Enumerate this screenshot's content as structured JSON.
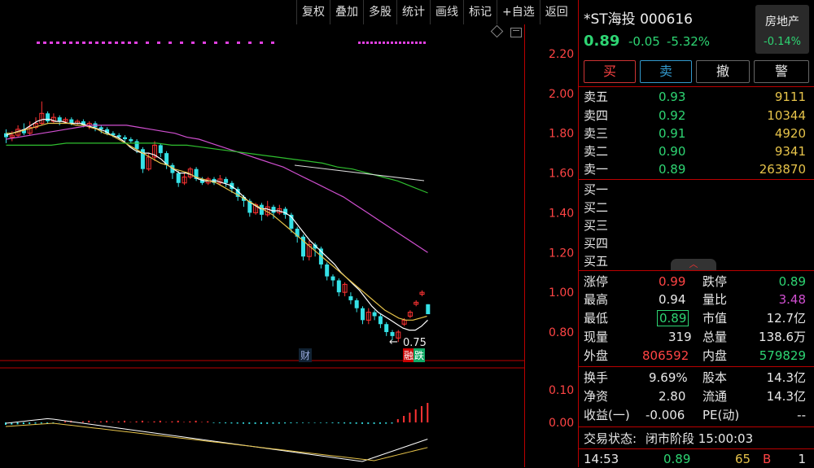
{
  "toolbar": [
    "复权",
    "叠加",
    "多股",
    "统计",
    "画线",
    "标记",
    "+自选",
    "返回"
  ],
  "axis": {
    "main_ticks": [
      "2.20",
      "2.00",
      "1.80",
      "1.60",
      "1.40",
      "1.20",
      "1.00",
      "0.80"
    ],
    "macd_ticks": [
      "0.10",
      "0.00"
    ]
  },
  "chart": {
    "low_label": "0.75",
    "marker_cai": "财",
    "marker_rong": "融",
    "marker_die": "跌",
    "colors": {
      "up": "#ff3333",
      "down": "#35e1e6",
      "ma5": "#ffffff",
      "ma10": "#e6c34a",
      "ma20": "#d04fd0",
      "ma60": "#2fbf2f",
      "magenta": "#e040e0"
    }
  },
  "chart_data": {
    "type": "candlestick",
    "ylim": [
      0.7,
      2.3
    ],
    "candles": [
      [
        1.8,
        1.78,
        1.82,
        1.75
      ],
      [
        1.78,
        1.79,
        1.81,
        1.76
      ],
      [
        1.79,
        1.82,
        1.84,
        1.78
      ],
      [
        1.82,
        1.8,
        1.85,
        1.79
      ],
      [
        1.8,
        1.83,
        1.86,
        1.79
      ],
      [
        1.83,
        1.85,
        1.88,
        1.82
      ],
      [
        1.85,
        1.9,
        1.96,
        1.84
      ],
      [
        1.9,
        1.86,
        1.91,
        1.85
      ],
      [
        1.86,
        1.88,
        1.9,
        1.85
      ],
      [
        1.88,
        1.86,
        1.89,
        1.84
      ],
      [
        1.86,
        1.87,
        1.88,
        1.85
      ],
      [
        1.87,
        1.85,
        1.88,
        1.84
      ],
      [
        1.85,
        1.86,
        1.87,
        1.84
      ],
      [
        1.86,
        1.84,
        1.87,
        1.83
      ],
      [
        1.84,
        1.85,
        1.86,
        1.82
      ],
      [
        1.85,
        1.83,
        1.86,
        1.81
      ],
      [
        1.83,
        1.82,
        1.84,
        1.8
      ],
      [
        1.82,
        1.8,
        1.83,
        1.79
      ],
      [
        1.8,
        1.79,
        1.81,
        1.78
      ],
      [
        1.79,
        1.78,
        1.8,
        1.77
      ],
      [
        1.78,
        1.77,
        1.79,
        1.76
      ],
      [
        1.77,
        1.76,
        1.78,
        1.75
      ],
      [
        1.76,
        1.72,
        1.77,
        1.7
      ],
      [
        1.72,
        1.62,
        1.73,
        1.6
      ],
      [
        1.62,
        1.68,
        1.7,
        1.61
      ],
      [
        1.68,
        1.74,
        1.76,
        1.66
      ],
      [
        1.74,
        1.7,
        1.75,
        1.68
      ],
      [
        1.7,
        1.64,
        1.71,
        1.62
      ],
      [
        1.64,
        1.6,
        1.65,
        1.57
      ],
      [
        1.6,
        1.55,
        1.61,
        1.53
      ],
      [
        1.55,
        1.58,
        1.6,
        1.54
      ],
      [
        1.58,
        1.62,
        1.63,
        1.57
      ],
      [
        1.62,
        1.57,
        1.63,
        1.56
      ],
      [
        1.57,
        1.55,
        1.58,
        1.54
      ],
      [
        1.55,
        1.57,
        1.58,
        1.54
      ],
      [
        1.57,
        1.55,
        1.58,
        1.54
      ],
      [
        1.55,
        1.57,
        1.59,
        1.54
      ],
      [
        1.57,
        1.55,
        1.58,
        1.53
      ],
      [
        1.55,
        1.52,
        1.56,
        1.5
      ],
      [
        1.52,
        1.48,
        1.53,
        1.46
      ],
      [
        1.48,
        1.46,
        1.49,
        1.43
      ],
      [
        1.46,
        1.4,
        1.47,
        1.38
      ],
      [
        1.4,
        1.44,
        1.45,
        1.39
      ],
      [
        1.44,
        1.39,
        1.45,
        1.36
      ],
      [
        1.39,
        1.43,
        1.46,
        1.38
      ],
      [
        1.43,
        1.4,
        1.44,
        1.37
      ],
      [
        1.4,
        1.42,
        1.44,
        1.39
      ],
      [
        1.42,
        1.39,
        1.43,
        1.37
      ],
      [
        1.39,
        1.32,
        1.4,
        1.3
      ],
      [
        1.32,
        1.28,
        1.33,
        1.25
      ],
      [
        1.28,
        1.18,
        1.29,
        1.16
      ],
      [
        1.18,
        1.24,
        1.26,
        1.16
      ],
      [
        1.24,
        1.22,
        1.25,
        1.18
      ],
      [
        1.22,
        1.14,
        1.23,
        1.12
      ],
      [
        1.14,
        1.08,
        1.15,
        1.06
      ],
      [
        1.08,
        1.06,
        1.09,
        1.03
      ],
      [
        1.06,
        1.0,
        1.07,
        0.98
      ],
      [
        1.0,
        1.04,
        1.05,
        0.98
      ],
      [
        0.98,
        0.96,
        1.0,
        0.94
      ],
      [
        0.96,
        0.92,
        0.97,
        0.9
      ],
      [
        0.92,
        0.86,
        0.93,
        0.84
      ],
      [
        0.86,
        0.9,
        0.92,
        0.84
      ],
      [
        0.9,
        0.88,
        0.91,
        0.86
      ],
      [
        0.88,
        0.84,
        0.89,
        0.82
      ],
      [
        0.84,
        0.8,
        0.85,
        0.78
      ],
      [
        0.8,
        0.78,
        0.81,
        0.76
      ],
      [
        0.77,
        0.8,
        0.81,
        0.75
      ],
      [
        0.84,
        0.86,
        0.87,
        0.83
      ],
      [
        0.88,
        0.9,
        0.91,
        0.87
      ],
      [
        0.94,
        0.95,
        0.96,
        0.93
      ],
      [
        0.99,
        1.0,
        1.01,
        0.98
      ],
      [
        0.94,
        0.89,
        0.94,
        0.89
      ]
    ],
    "ma5": [
      1.79,
      1.8,
      1.81,
      1.82,
      1.84,
      1.86,
      1.87,
      1.87,
      1.86,
      1.86,
      1.85,
      1.85,
      1.85,
      1.84,
      1.83,
      1.82,
      1.81,
      1.79,
      1.78,
      1.76,
      1.73,
      1.71,
      1.7,
      1.7,
      1.69,
      1.67,
      1.64,
      1.62,
      1.6,
      1.6,
      1.59,
      1.57,
      1.56,
      1.56,
      1.56,
      1.55,
      1.54,
      1.52,
      1.49,
      1.46,
      1.44,
      1.42,
      1.42,
      1.41,
      1.41,
      1.4,
      1.38,
      1.34,
      1.3,
      1.26,
      1.23,
      1.2,
      1.17,
      1.14,
      1.1,
      1.07,
      1.04,
      1.01,
      0.97,
      0.93,
      0.9,
      0.88,
      0.86,
      0.84,
      0.82,
      0.81,
      0.81,
      0.83,
      0.86
    ],
    "ma10": [
      1.8,
      1.8,
      1.81,
      1.82,
      1.83,
      1.84,
      1.85,
      1.85,
      1.85,
      1.85,
      1.84,
      1.84,
      1.83,
      1.82,
      1.8,
      1.79,
      1.77,
      1.75,
      1.73,
      1.71,
      1.69,
      1.67,
      1.65,
      1.64,
      1.62,
      1.61,
      1.6,
      1.58,
      1.57,
      1.56,
      1.55,
      1.53,
      1.51,
      1.49,
      1.47,
      1.45,
      1.43,
      1.41,
      1.39,
      1.36,
      1.33,
      1.3,
      1.27,
      1.24,
      1.21,
      1.18,
      1.15,
      1.12,
      1.09,
      1.06,
      1.03,
      1.0,
      0.97,
      0.94,
      0.91,
      0.89,
      0.87,
      0.86,
      0.86,
      0.87,
      0.88
    ],
    "ma20": [
      1.77,
      1.78,
      1.79,
      1.8,
      1.81,
      1.82,
      1.83,
      1.84,
      1.84,
      1.84,
      1.84,
      1.83,
      1.82,
      1.81,
      1.8,
      1.78,
      1.77,
      1.75,
      1.73,
      1.71,
      1.69,
      1.67,
      1.65,
      1.63,
      1.6,
      1.57,
      1.54,
      1.51,
      1.48,
      1.44,
      1.4,
      1.36,
      1.32,
      1.28,
      1.24,
      1.2
    ],
    "ma60": [
      1.74,
      1.74,
      1.74,
      1.74,
      1.75,
      1.75,
      1.75,
      1.75,
      1.75,
      1.75,
      1.75,
      1.74,
      1.74,
      1.73,
      1.72,
      1.71,
      1.7,
      1.69,
      1.68,
      1.67,
      1.66,
      1.65,
      1.63,
      1.62,
      1.6,
      1.58,
      1.56,
      1.53,
      1.5
    ]
  },
  "panel": {
    "title": "*ST海投 000616",
    "price": "0.89",
    "change": "-0.05",
    "change_pct": "-5.32%",
    "sector_name": "房地产",
    "sector_chg": "-0.14%",
    "buttons": [
      "买",
      "卖",
      "撤",
      "警"
    ],
    "asks": [
      {
        "label": "卖五",
        "price": "0.93",
        "vol": "9111"
      },
      {
        "label": "卖四",
        "price": "0.92",
        "vol": "10344"
      },
      {
        "label": "卖三",
        "price": "0.91",
        "vol": "4920"
      },
      {
        "label": "卖二",
        "price": "0.90",
        "vol": "9341"
      },
      {
        "label": "卖一",
        "price": "0.89",
        "vol": "263870"
      }
    ],
    "bids": [
      "买一",
      "买二",
      "买三",
      "买四",
      "买五"
    ],
    "stats": [
      {
        "l1": "涨停",
        "v1": "0.99",
        "l2": "跌停",
        "v2": "0.89"
      },
      {
        "l1": "最高",
        "v1": "0.94",
        "l2": "量比",
        "v2": "3.48"
      },
      {
        "l1": "最低",
        "v1": "0.89",
        "l2": "市值",
        "v2": "12.7亿"
      },
      {
        "l1": "现量",
        "v1": "319",
        "l2": "总量",
        "v2": "138.6万"
      },
      {
        "l1": "外盘",
        "v1": "806592",
        "l2": "内盘",
        "v2": "579829"
      }
    ],
    "stats2": [
      {
        "l1": "换手",
        "v1": "9.69%",
        "l2": "股本",
        "v2": "14.3亿"
      },
      {
        "l1": "净资",
        "v1": "2.80",
        "l2": "流通",
        "v2": "14.3亿"
      },
      {
        "l1": "收益(一)",
        "v1": "-0.006",
        "l2": "PE(动)",
        "v2": "--"
      }
    ],
    "status_label": "交易状态:",
    "status_value": "闭市阶段 15:00:03",
    "tick": {
      "time": "14:53",
      "price": "0.89",
      "vol": "65",
      "side": "B",
      "num": "1"
    }
  }
}
